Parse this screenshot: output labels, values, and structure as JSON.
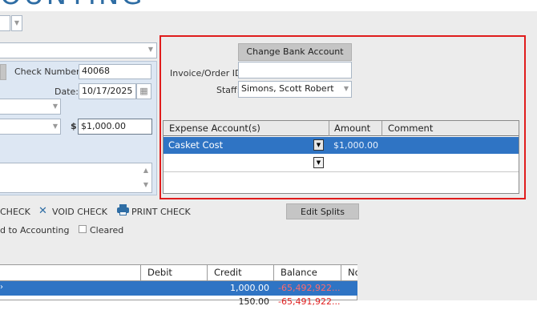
{
  "header": {
    "title": "OUNTING"
  },
  "check_form": {
    "check_number_label": "Check Number:",
    "check_number": "40068",
    "date_label": "Date:",
    "date": "10/17/2025",
    "currency_symbol": "$",
    "amount": "$1,000.00"
  },
  "split_panel": {
    "change_bank_button": "Change Bank Account",
    "invoice_label": "Invoice/Order ID:",
    "invoice_value": "",
    "staff_label": "Staff:",
    "staff_value": "Simons, Scott Robert",
    "grid": {
      "columns": [
        "Expense Account(s)",
        "Amount",
        "Comment"
      ],
      "rows": [
        {
          "account": "Casket Cost",
          "amount": "$1,000.00",
          "comment": ""
        }
      ]
    }
  },
  "actions": {
    "check_partial": "CHECK",
    "void_check": "VOID CHECK",
    "print_check": "PRINT CHECK",
    "edit_splits": "Edit Splits",
    "send_to_accounting_partial": "d to Accounting",
    "cleared_label": "Cleared"
  },
  "ledger": {
    "columns": [
      "Debit",
      "Credit",
      "Balance",
      "No"
    ],
    "rows": [
      {
        "debit": "",
        "credit": "1,000.00",
        "balance": "-65,492,922..."
      },
      {
        "debit": "",
        "credit": "150.00",
        "balance": "-65,491,922..."
      }
    ]
  },
  "colors": {
    "selection": "#2f74c4",
    "frame": "#e01c1c",
    "negative": "#ff6a6a"
  }
}
